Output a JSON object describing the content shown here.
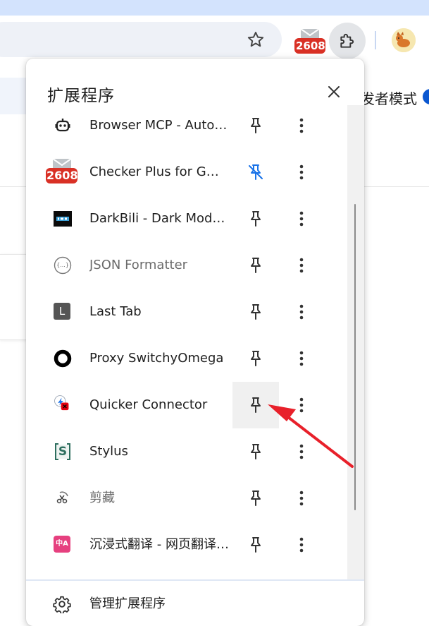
{
  "toolbar": {
    "bookmark_icon": "star-icon",
    "checker_badge": "2608",
    "extensions_icon": "puzzle-icon",
    "avatar_icon": "profile-avatar"
  },
  "background": {
    "dev_mode_label": "发者模式"
  },
  "popup": {
    "title": "扩展程序",
    "close_icon": "close-icon",
    "extensions": [
      {
        "name": "Browser MCP - Automate your browser using VS Code, Cursor, Claude, and more",
        "icon": "robot-icon",
        "pinned": false,
        "muted": false
      },
      {
        "name": "Checker Plus for Gmail™",
        "icon": "checker-plus-icon",
        "badge": "2608",
        "pinned": true,
        "muted": false
      },
      {
        "name": "DarkBili - Dark Mode for Bilibili",
        "icon": "darkbili-icon",
        "pinned": false,
        "muted": false
      },
      {
        "name": "JSON Formatter",
        "icon": "json-formatter-icon",
        "glyph": "{...}",
        "pinned": false,
        "muted": true
      },
      {
        "name": "Last Tab",
        "icon": "last-tab-icon",
        "glyph": "L",
        "pinned": false,
        "muted": false
      },
      {
        "name": "Proxy SwitchyOmega",
        "icon": "switchyomega-icon",
        "pinned": false,
        "muted": false
      },
      {
        "name": "Quicker Connector",
        "icon": "quicker-icon",
        "pinned": false,
        "muted": false,
        "hovered": true
      },
      {
        "name": "Stylus",
        "icon": "stylus-icon",
        "glyph": "S",
        "pinned": false,
        "muted": false
      },
      {
        "name": "剪藏",
        "icon": "clip-icon",
        "pinned": false,
        "muted": true
      },
      {
        "name": "沉浸式翻译 - 网页翻译插件 | PDF 翻译 | 免费",
        "icon": "immersive-translate-icon",
        "glyph": "中A",
        "pinned": false,
        "muted": false
      }
    ],
    "footer_label": "管理扩展程序",
    "footer_icon": "gear-icon"
  },
  "colors": {
    "accent_blue": "#1a73e8",
    "annotation_red": "#e8202a",
    "checker_red": "#d93025"
  }
}
